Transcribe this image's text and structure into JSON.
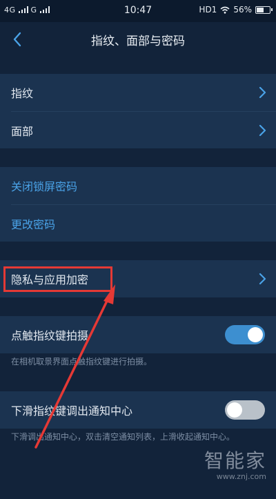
{
  "status_bar": {
    "signal_left": "4G",
    "signal_right": "G",
    "time": "10:47",
    "network": "HD1",
    "battery": "56%",
    "battery_level": 0.56
  },
  "header": {
    "title": "指纹、面部与密码"
  },
  "group1": [
    {
      "label": "指纹"
    },
    {
      "label": "面部"
    }
  ],
  "group2": [
    {
      "label": "关闭锁屏密码"
    },
    {
      "label": "更改密码"
    }
  ],
  "privacy": {
    "label": "隐私与应用加密"
  },
  "capture": {
    "label": "点触指纹键拍摄",
    "enabled": true,
    "description": "在相机取景界面点触指纹键进行拍摄。"
  },
  "notify": {
    "label": "下滑指纹键调出通知中心",
    "enabled": false,
    "description": "下滑调出通知中心，双击清空通知列表，上滑收起通知中心。"
  },
  "watermark": {
    "logo": "智能家",
    "url": "www.znj.com"
  },
  "colors": {
    "accent": "#4aa3e8",
    "toggle_on": "#3d8fd0",
    "toggle_off": "#b9c1c9",
    "annotation": "#e53935"
  }
}
